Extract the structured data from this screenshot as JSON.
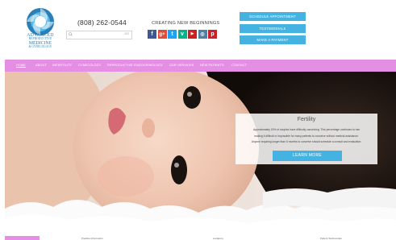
{
  "brand": {
    "logo_line1": "ADVANCED",
    "logo_line2": "REPRODUCTIVE",
    "logo_line3": "MEDICINE",
    "logo_line4": "& GYNECOLOGY",
    "logo_color": "#2a7fb6"
  },
  "header": {
    "phone": "(808) 262-0544",
    "search_placeholder": "",
    "search_go": "GO",
    "tagline": "CREATING NEW BEGINNINGS"
  },
  "social": [
    {
      "name": "facebook-icon",
      "glyph": "f",
      "color": "#3b5998"
    },
    {
      "name": "google-plus-icon",
      "glyph": "g+",
      "color": "#dd4b39"
    },
    {
      "name": "twitter-icon",
      "glyph": "t",
      "color": "#1da1f2"
    },
    {
      "name": "vine-icon",
      "glyph": "v",
      "color": "#00b488"
    },
    {
      "name": "youtube-icon",
      "glyph": "▶",
      "color": "#cd201f"
    },
    {
      "name": "instagram-icon",
      "glyph": "◎",
      "color": "#517fa4"
    },
    {
      "name": "pinterest-icon",
      "glyph": "p",
      "color": "#cb2027"
    }
  ],
  "cta": {
    "schedule": "SCHEDULE APPOINTMENT",
    "testimonials": "TESTIMONIALS",
    "payment": "MAKE A PAYMENT"
  },
  "nav": {
    "home": "HOME",
    "about": "ABOUT",
    "infertility": "INFERTILITY",
    "gynecology": "GYNECOLOGY",
    "rei": "REPRODUCTIVE ENDOCRINOLOGY",
    "services": "OUR SERVICES",
    "new_patients": "NEW PATIENTS",
    "contact": "CONTACT"
  },
  "hero": {
    "title": "Fertility",
    "line1": "Approximately 15% of couples have difficulty conceiving. This percentage continues to rise",
    "line2": "making it difficult or impossible for many patients to conceive without medical assistance.",
    "line3": "Anyone requiring longer than 6 months to conceive should schedule a consult and evaluation.",
    "button": "LEARN MORE"
  },
  "footer_strip": {
    "col1": "Practice Information",
    "col2": "Locations",
    "col3": "Patient Testimonials"
  },
  "colors": {
    "accent_blue": "#44b3e2",
    "nav_pink": "#e48ee4"
  }
}
